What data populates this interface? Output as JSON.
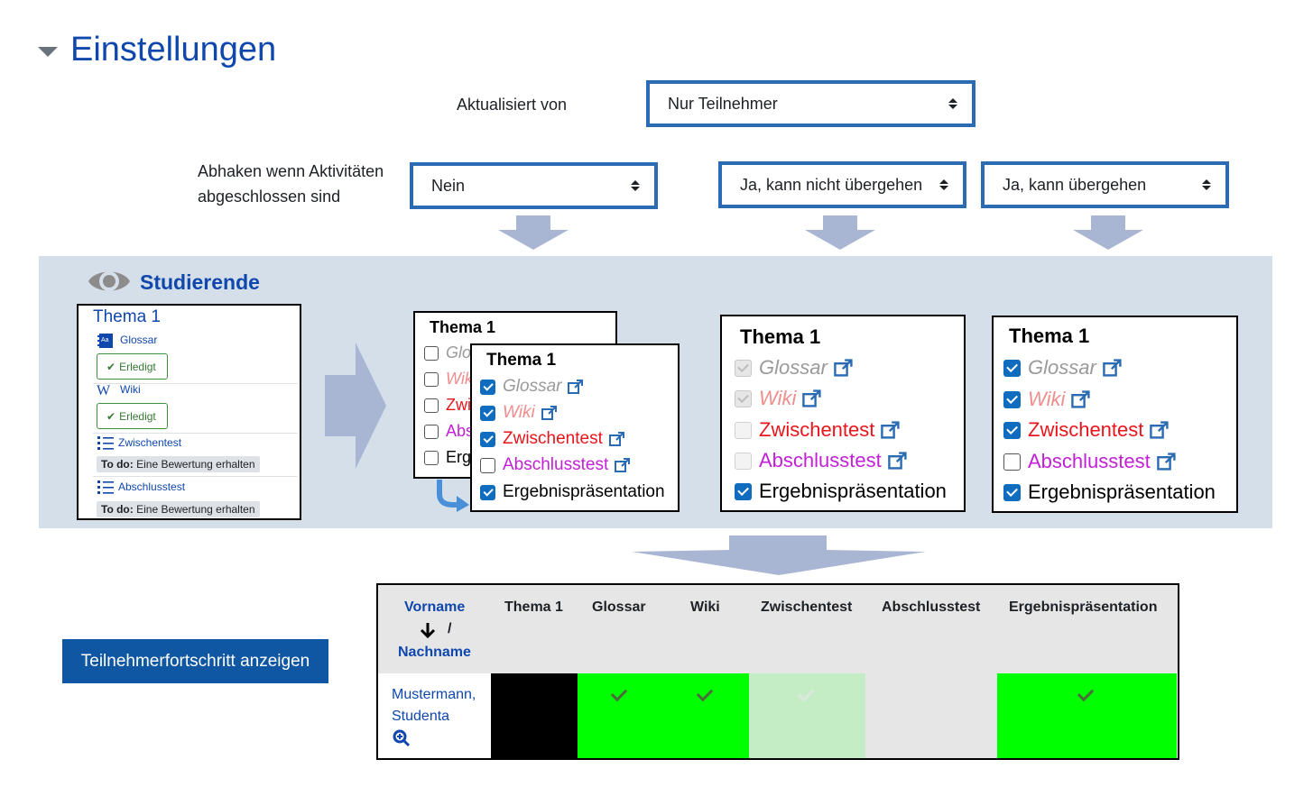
{
  "header": {
    "title": "Einstellungen"
  },
  "settings": {
    "updated_by_label": "Aktualisiert von",
    "updated_by_value": "Nur Teilnehmer",
    "tick_label_line1": "Abhaken wenn Aktivitäten",
    "tick_label_line2": "abgeschlossen sind",
    "options": [
      "Nein",
      "Ja, kann nicht übergehen",
      "Ja, kann übergehen"
    ]
  },
  "students": {
    "role_title": "Studierende",
    "course": {
      "title": "Thema 1",
      "activities": [
        {
          "name": "Glossar",
          "icon": "glossary-icon",
          "status": "Erledigt"
        },
        {
          "name": "Wiki",
          "icon": "wiki-icon",
          "status": "Erledigt"
        },
        {
          "name": "Zwischentest",
          "icon": "quiz-icon",
          "todo_prefix": "To do:",
          "todo_text": "Eine Bewertung erhalten"
        },
        {
          "name": "Abschlusstest",
          "icon": "quiz-icon",
          "todo_prefix": "To do:",
          "todo_text": "Eine Bewertung erhalten"
        }
      ]
    },
    "box_title": "Thema 1",
    "back_items": [
      "Glo",
      "Wik",
      "Zwi",
      "Abs",
      "Erg"
    ],
    "items": [
      "Glossar",
      "Wiki",
      "Zwischentest",
      "Abschlusstest",
      "Ergebnispräsentation"
    ],
    "states": {
      "nein": [
        true,
        true,
        true,
        false,
        true
      ],
      "nicht_uebergehen": [
        true,
        true,
        false,
        false,
        true
      ],
      "uebergehen": [
        true,
        true,
        true,
        false,
        true
      ]
    }
  },
  "progress": {
    "button_label": "Teilnehmerfortschritt anzeigen",
    "columns": {
      "vorname": "Vorname",
      "sort_sep": "/",
      "nachname": "Nachname",
      "thema": "Thema 1",
      "glossar": "Glossar",
      "wiki": "Wiki",
      "zwischentest": "Zwischentest",
      "abschlusstest": "Abschlusstest",
      "ergebnis": "Ergebnispräsentation"
    },
    "student_name_line1": "Mustermann,",
    "student_name_line2": "Studenta",
    "cells": [
      {
        "col": "Thema 1",
        "color": "#000000",
        "check": false
      },
      {
        "col": "Glossar",
        "color": "#00ff00",
        "check": true
      },
      {
        "col": "Wiki",
        "color": "#00ff00",
        "check": true
      },
      {
        "col": "Zwischentest",
        "color": "#c5edc5",
        "check": true
      },
      {
        "col": "Abschlusstest",
        "color": "#e6e6e6",
        "check": false
      },
      {
        "col": "Ergebnispräsentation",
        "color": "#00ff00",
        "check": true
      }
    ]
  },
  "colors": {
    "accent": "#0f47ad",
    "select_border": "#2a6bb3",
    "band": "#d5dfe9",
    "arrow": "#a9b6d3"
  }
}
